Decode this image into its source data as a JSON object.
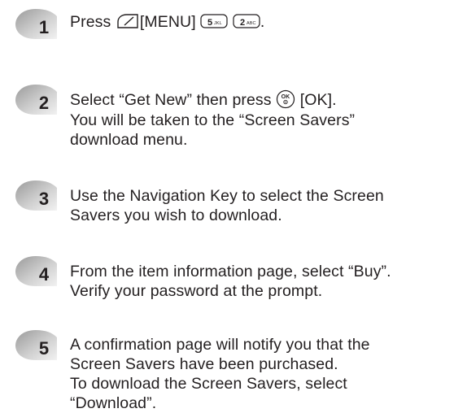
{
  "steps": [
    {
      "number": "1",
      "parts": {
        "press": "Press",
        "menu_label": "[MENU]",
        "key1_digit": "5",
        "key1_letters": "JKL",
        "key2_digit": "2",
        "key2_letters": "ABC",
        "period": "."
      },
      "icon": "softkey-icon"
    },
    {
      "number": "2",
      "parts": {
        "line1_prefix": "Select “Get New” then press",
        "ok_key": "OK",
        "ok_label": "[OK].",
        "line2": "You will be taken to the “Screen Savers”",
        "line3": "download menu."
      },
      "icon": "ok-key-icon"
    },
    {
      "number": "3",
      "lines": [
        "Use the Navigation Key to select the Screen",
        "Savers you wish to download."
      ]
    },
    {
      "number": "4",
      "lines": [
        "From the item information page, select “Buy”.",
        "Verify your password at the prompt."
      ]
    },
    {
      "number": "5",
      "lines": [
        "A confirmation page will notify you that the",
        "Screen Savers have been purchased.",
        "To download the Screen Savers, select",
        "“Download”."
      ]
    }
  ],
  "colors": {
    "text": "#231f20",
    "badge_dark": "#8a8a8a",
    "badge_light": "#e6e6e6"
  }
}
